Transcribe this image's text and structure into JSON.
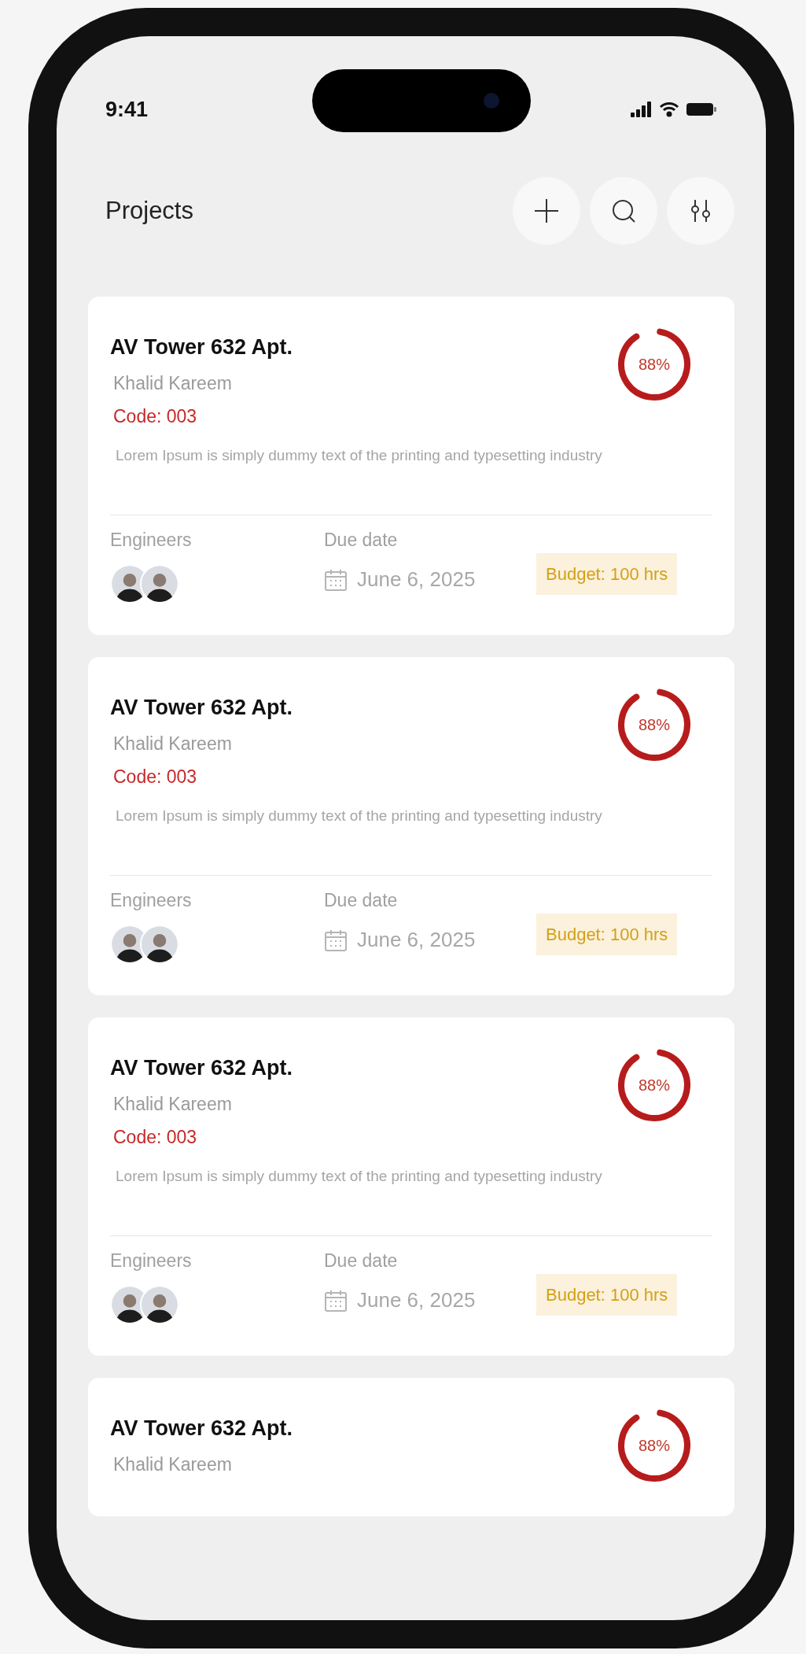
{
  "status_bar": {
    "time": "9:41"
  },
  "header": {
    "title": "Projects",
    "actions": [
      {
        "kind": "add"
      },
      {
        "kind": "search"
      },
      {
        "kind": "filter"
      }
    ]
  },
  "projects": [
    {
      "title": "AV Tower 632 Apt.",
      "owner": "Khalid Kareem",
      "code": "Code: 003",
      "description": "Lorem Ipsum is simply dummy text of the printing and typesetting industry",
      "engineers_label": "Engineers",
      "due_label": "Due date",
      "due_date": "June 6, 2025",
      "budget": "Budget: 100 hrs",
      "progress": {
        "level": 0.88,
        "reading": "88%"
      }
    },
    {
      "title": "AV Tower 632 Apt.",
      "owner": "Khalid Kareem",
      "code": "Code: 003",
      "description": "Lorem Ipsum is simply dummy text of the printing and typesetting industry",
      "engineers_label": "Engineers",
      "due_label": "Due date",
      "due_date": "June 6, 2025",
      "budget": "Budget: 100 hrs",
      "progress": {
        "level": 0.88,
        "reading": "88%"
      }
    },
    {
      "title": "AV Tower 632 Apt.",
      "owner": "Khalid Kareem",
      "code": "Code: 003",
      "description": "Lorem Ipsum is simply dummy text of the printing and typesetting industry",
      "engineers_label": "Engineers",
      "due_label": "Due date",
      "due_date": "June 6, 2025",
      "budget": "Budget: 100 hrs",
      "progress": {
        "level": 0.88,
        "reading": "88%"
      }
    },
    {
      "title": "AV Tower 632 Apt.",
      "owner": "Khalid Kareem",
      "progress": {
        "level": 0.88,
        "reading": "88%"
      }
    }
  ]
}
